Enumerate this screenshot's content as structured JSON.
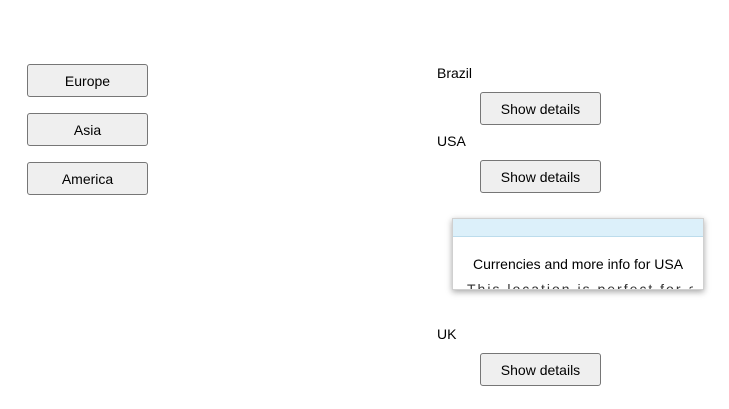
{
  "regions": {
    "europe_label": "Europe",
    "asia_label": "Asia",
    "america_label": "America"
  },
  "countries": {
    "brazil": {
      "name": "Brazil",
      "button_label": "Show details"
    },
    "usa": {
      "name": "USA",
      "button_label": "Show details"
    },
    "uk": {
      "name": "UK",
      "button_label": "Show details"
    }
  },
  "popup": {
    "title": "Currencies and more info for USA",
    "body": "This location is perfect for a"
  },
  "colors": {
    "button_bg": "#efefef",
    "button_border": "#767676",
    "popup_header": "#dcf0fa"
  }
}
